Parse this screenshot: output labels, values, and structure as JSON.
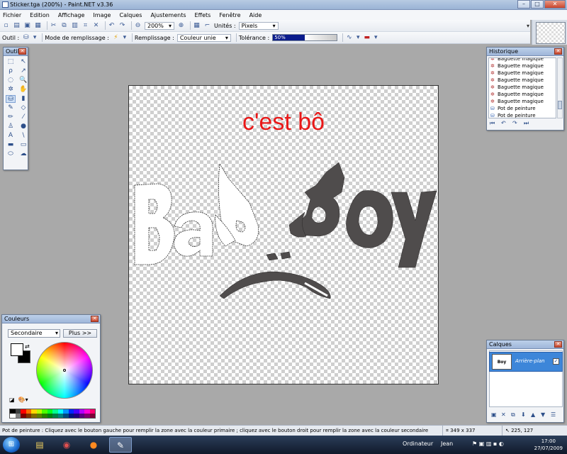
{
  "window": {
    "title": "Sticker.tga (200%) - Paint.NET v3.36",
    "min": "–",
    "max": "□",
    "close": "✕"
  },
  "menu": [
    "Fichier",
    "Edition",
    "Affichage",
    "Image",
    "Calques",
    "Ajustements",
    "Effets",
    "Fenêtre",
    "Aide"
  ],
  "toolbar": {
    "zoom": "200%",
    "units_label": "Unités :",
    "units_value": "Pixels",
    "tool_label": "Outil :",
    "fill_mode_label": "Mode de remplissage :",
    "fill_label": "Remplissage :",
    "fill_value": "Couleur unie",
    "tolerance_label": "Tolérance :",
    "tolerance_value": "50%",
    "tolerance_fraction": 0.5
  },
  "canvas": {
    "caption": "c'est bô",
    "caption_color": "#e81818",
    "art_color": "#4f4c4c"
  },
  "tools_panel": {
    "title": "Outils",
    "tools": [
      {
        "name": "rect-select-tool",
        "glyph": "⬚"
      },
      {
        "name": "move-selection-tool",
        "glyph": "↖"
      },
      {
        "name": "lasso-tool",
        "glyph": "ρ"
      },
      {
        "name": "move-selected-tool",
        "glyph": "↗"
      },
      {
        "name": "ellipse-select-tool",
        "glyph": "◌"
      },
      {
        "name": "zoom-tool",
        "glyph": "🔍"
      },
      {
        "name": "magic-wand-tool",
        "glyph": "✲"
      },
      {
        "name": "pan-tool",
        "glyph": "✋"
      },
      {
        "name": "paint-bucket-tool",
        "glyph": "⛁"
      },
      {
        "name": "gradient-tool",
        "glyph": "▮"
      },
      {
        "name": "paintbrush-tool",
        "glyph": "✎"
      },
      {
        "name": "eraser-tool",
        "glyph": "◇"
      },
      {
        "name": "pencil-tool",
        "glyph": "✏"
      },
      {
        "name": "color-picker-tool",
        "glyph": "⁄"
      },
      {
        "name": "clone-stamp-tool",
        "glyph": "♙"
      },
      {
        "name": "recolor-tool",
        "glyph": "●"
      },
      {
        "name": "text-tool",
        "glyph": "A"
      },
      {
        "name": "line-tool",
        "glyph": "\\"
      },
      {
        "name": "rectangle-tool",
        "glyph": "▬"
      },
      {
        "name": "rounded-rect-tool",
        "glyph": "▭"
      },
      {
        "name": "ellipse-tool",
        "glyph": "⬭"
      },
      {
        "name": "freeform-shape-tool",
        "glyph": "☁"
      }
    ]
  },
  "history_panel": {
    "title": "Historique",
    "items": [
      {
        "label": "Baguette magique",
        "icon": "wand"
      },
      {
        "label": "Baguette magique",
        "icon": "wand"
      },
      {
        "label": "Baguette magique",
        "icon": "wand"
      },
      {
        "label": "Baguette magique",
        "icon": "wand"
      },
      {
        "label": "Baguette magique",
        "icon": "wand"
      },
      {
        "label": "Baguette magique",
        "icon": "wand"
      },
      {
        "label": "Baguette magique",
        "icon": "wand"
      },
      {
        "label": "Pot de peinture",
        "icon": "bucket"
      },
      {
        "label": "Pot de peinture",
        "icon": "bucket"
      },
      {
        "label": "Pot de peinture",
        "icon": "bucket"
      }
    ]
  },
  "colors_panel": {
    "title": "Couleurs",
    "selector": "Secondaire",
    "more_button": "Plus >>",
    "primary": "#ffffff",
    "secondary": "#000000",
    "palette": [
      "#000000",
      "#404040",
      "#ff0000",
      "#ff6a00",
      "#ffd800",
      "#b6ff00",
      "#4cff00",
      "#00ff21",
      "#00ff90",
      "#00ffff",
      "#0094ff",
      "#0026ff",
      "#4800ff",
      "#b200ff",
      "#ff00dc",
      "#ff006e",
      "#ffffff",
      "#808080",
      "#7f0000",
      "#7f3300",
      "#7f6a00",
      "#5b7f00",
      "#267f00",
      "#007f0e",
      "#007f46",
      "#007f7f",
      "#004a7f",
      "#00137f",
      "#21007f",
      "#57007f",
      "#7f006e",
      "#7f0037"
    ]
  },
  "layers_panel": {
    "title": "Calques",
    "layer_name": "Arrière-plan",
    "layer_visible": true
  },
  "status": {
    "message": "Pot de peinture : Cliquez avec le bouton gauche pour remplir la zone avec la couleur primaire ; cliquez avec le bouton droit pour remplir la zone avec la couleur secondaire",
    "size": "349 x 337",
    "coords": "225, 127"
  },
  "taskbar": {
    "computer": "Ordinateur",
    "user": "Jean",
    "time": "17:00",
    "date": "27/07/2009"
  }
}
